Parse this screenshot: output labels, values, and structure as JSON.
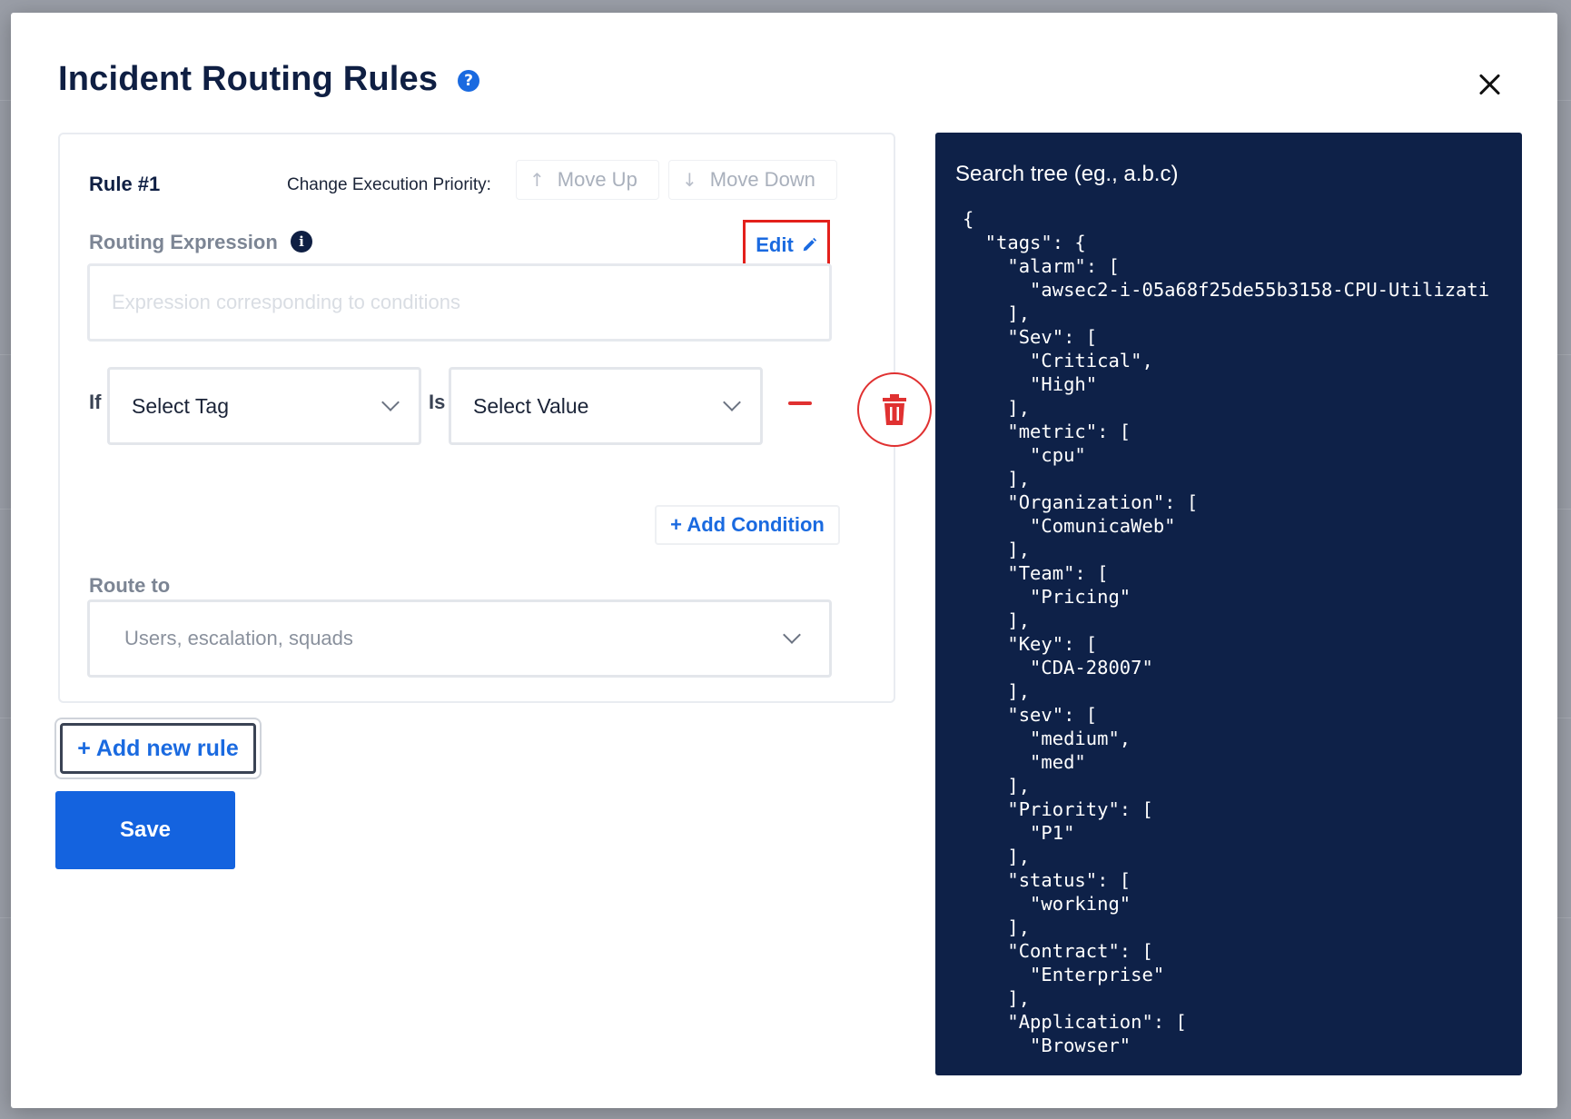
{
  "modal": {
    "title": "Incident Routing Rules",
    "help_icon": "question-circle-icon",
    "close_icon": "close-icon"
  },
  "rule": {
    "label": "Rule #1",
    "priority_label": "Change Execution Priority:",
    "move_up_label": "Move Up",
    "move_down_label": "Move Down",
    "routing_expression_label": "Routing Expression",
    "edit_label": "Edit",
    "expression_placeholder": "Expression corresponding to conditions",
    "expression_value": "",
    "if_label": "If",
    "is_label": "Is",
    "tag_select": "Select Tag",
    "value_select": "Select Value",
    "add_condition_label": "+ Add Condition",
    "route_to_label": "Route to",
    "route_to_placeholder": "Users, escalation, squads"
  },
  "actions": {
    "add_rule_label": "+ Add new rule",
    "save_label": "Save"
  },
  "tree": {
    "search_placeholder": "Search tree (eg., a.b.c)",
    "lines": [
      "{",
      "  \"tags\": {",
      "    \"alarm\": [",
      "      \"awsec2-i-05a68f25de55b3158-CPU-Utilizati",
      "    ],",
      "    \"Sev\": [",
      "      \"Critical\",",
      "      \"High\"",
      "    ],",
      "    \"metric\": [",
      "      \"cpu\"",
      "    ],",
      "    \"Organization\": [",
      "      \"ComunicaWeb\"",
      "    ],",
      "    \"Team\": [",
      "      \"Pricing\"",
      "    ],",
      "    \"Key\": [",
      "      \"CDA-28007\"",
      "    ],",
      "    \"sev\": [",
      "      \"medium\",",
      "      \"med\"",
      "    ],",
      "    \"Priority\": [",
      "      \"P1\"",
      "    ],",
      "    \"status\": [",
      "      \"working\"",
      "    ],",
      "    \"Contract\": [",
      "      \"Enterprise\"",
      "    ],",
      "    \"Application\": [",
      "      \"Browser\""
    ]
  },
  "colors": {
    "accent": "#1a6ae0",
    "danger": "#e03131",
    "panel": "#0e2148",
    "title": "#0f1f43"
  }
}
